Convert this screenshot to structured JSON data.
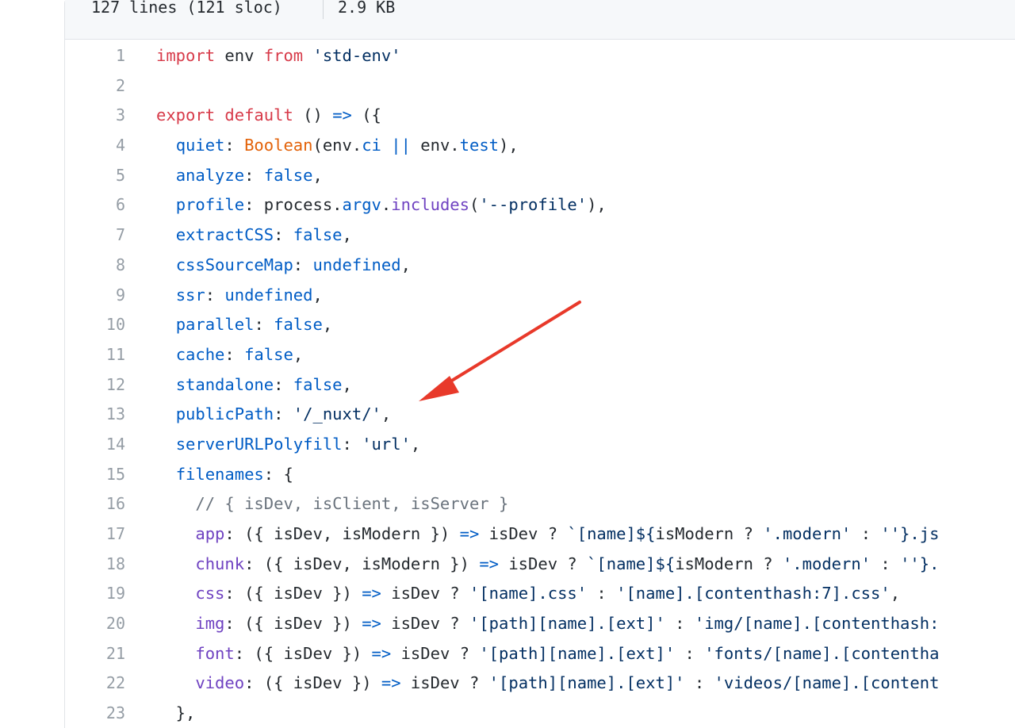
{
  "file_header": {
    "lines_info": "127 lines (121 sloc)",
    "size": "2.9 KB"
  },
  "annotation": {
    "type": "red-arrow",
    "color": "#e8392a",
    "points_to_line": 13
  },
  "colors": {
    "keyword": "#d73a49",
    "string": "#032f62",
    "comment": "#6a737d",
    "property": "#005cc5",
    "function": "#6f42c1",
    "builtin": "#e36209",
    "line_number": "#959da5"
  },
  "code": {
    "lines": [
      {
        "n": "1",
        "tokens": [
          [
            "k",
            "import"
          ],
          [
            "d",
            " env "
          ],
          [
            "k",
            "from"
          ],
          [
            "d",
            " "
          ],
          [
            "s",
            "'std-env'"
          ]
        ]
      },
      {
        "n": "2",
        "tokens": []
      },
      {
        "n": "3",
        "tokens": [
          [
            "k",
            "export"
          ],
          [
            "d",
            " "
          ],
          [
            "k",
            "default"
          ],
          [
            "d",
            " () "
          ],
          [
            "p",
            "=>"
          ],
          [
            "d",
            " ({"
          ]
        ]
      },
      {
        "n": "4",
        "tokens": [
          [
            "d",
            "  "
          ],
          [
            "p",
            "quiet"
          ],
          [
            "d",
            ": "
          ],
          [
            "b",
            "Boolean"
          ],
          [
            "d",
            "(env."
          ],
          [
            "p",
            "ci"
          ],
          [
            "d",
            " "
          ],
          [
            "p",
            "||"
          ],
          [
            "d",
            " env."
          ],
          [
            "p",
            "test"
          ],
          [
            "d",
            "),"
          ]
        ]
      },
      {
        "n": "5",
        "tokens": [
          [
            "d",
            "  "
          ],
          [
            "p",
            "analyze"
          ],
          [
            "d",
            ": "
          ],
          [
            "p",
            "false"
          ],
          [
            "d",
            ","
          ]
        ]
      },
      {
        "n": "6",
        "tokens": [
          [
            "d",
            "  "
          ],
          [
            "p",
            "profile"
          ],
          [
            "d",
            ": process."
          ],
          [
            "p",
            "argv"
          ],
          [
            "d",
            "."
          ],
          [
            "f",
            "includes"
          ],
          [
            "d",
            "("
          ],
          [
            "s",
            "'--profile'"
          ],
          [
            "d",
            "),"
          ]
        ]
      },
      {
        "n": "7",
        "tokens": [
          [
            "d",
            "  "
          ],
          [
            "p",
            "extractCSS"
          ],
          [
            "d",
            ": "
          ],
          [
            "p",
            "false"
          ],
          [
            "d",
            ","
          ]
        ]
      },
      {
        "n": "8",
        "tokens": [
          [
            "d",
            "  "
          ],
          [
            "p",
            "cssSourceMap"
          ],
          [
            "d",
            ": "
          ],
          [
            "p",
            "undefined"
          ],
          [
            "d",
            ","
          ]
        ]
      },
      {
        "n": "9",
        "tokens": [
          [
            "d",
            "  "
          ],
          [
            "p",
            "ssr"
          ],
          [
            "d",
            ": "
          ],
          [
            "p",
            "undefined"
          ],
          [
            "d",
            ","
          ]
        ]
      },
      {
        "n": "10",
        "tokens": [
          [
            "d",
            "  "
          ],
          [
            "p",
            "parallel"
          ],
          [
            "d",
            ": "
          ],
          [
            "p",
            "false"
          ],
          [
            "d",
            ","
          ]
        ]
      },
      {
        "n": "11",
        "tokens": [
          [
            "d",
            "  "
          ],
          [
            "p",
            "cache"
          ],
          [
            "d",
            ": "
          ],
          [
            "p",
            "false"
          ],
          [
            "d",
            ","
          ]
        ]
      },
      {
        "n": "12",
        "tokens": [
          [
            "d",
            "  "
          ],
          [
            "p",
            "standalone"
          ],
          [
            "d",
            ": "
          ],
          [
            "p",
            "false"
          ],
          [
            "d",
            ","
          ]
        ]
      },
      {
        "n": "13",
        "tokens": [
          [
            "d",
            "  "
          ],
          [
            "p",
            "publicPath"
          ],
          [
            "d",
            ": "
          ],
          [
            "s",
            "'/_nuxt/'"
          ],
          [
            "d",
            ","
          ]
        ]
      },
      {
        "n": "14",
        "tokens": [
          [
            "d",
            "  "
          ],
          [
            "p",
            "serverURLPolyfill"
          ],
          [
            "d",
            ": "
          ],
          [
            "s",
            "'url'"
          ],
          [
            "d",
            ","
          ]
        ]
      },
      {
        "n": "15",
        "tokens": [
          [
            "d",
            "  "
          ],
          [
            "p",
            "filenames"
          ],
          [
            "d",
            ": {"
          ]
        ]
      },
      {
        "n": "16",
        "tokens": [
          [
            "d",
            "    "
          ],
          [
            "c",
            "// { isDev, isClient, isServer }"
          ]
        ]
      },
      {
        "n": "17",
        "tokens": [
          [
            "d",
            "    "
          ],
          [
            "f",
            "app"
          ],
          [
            "d",
            ": ({ isDev, isModern }) "
          ],
          [
            "p",
            "=>"
          ],
          [
            "d",
            " isDev ? "
          ],
          [
            "s",
            "`[name]${"
          ],
          [
            "d",
            "isModern ? "
          ],
          [
            "s",
            "'.modern'"
          ],
          [
            "d",
            " : "
          ],
          [
            "s",
            "''"
          ],
          [
            "s",
            "}.js"
          ]
        ]
      },
      {
        "n": "18",
        "tokens": [
          [
            "d",
            "    "
          ],
          [
            "f",
            "chunk"
          ],
          [
            "d",
            ": ({ isDev, isModern }) "
          ],
          [
            "p",
            "=>"
          ],
          [
            "d",
            " isDev ? "
          ],
          [
            "s",
            "`[name]${"
          ],
          [
            "d",
            "isModern ? "
          ],
          [
            "s",
            "'.modern'"
          ],
          [
            "d",
            " : "
          ],
          [
            "s",
            "''"
          ],
          [
            "s",
            "}."
          ]
        ]
      },
      {
        "n": "19",
        "tokens": [
          [
            "d",
            "    "
          ],
          [
            "f",
            "css"
          ],
          [
            "d",
            ": ({ isDev }) "
          ],
          [
            "p",
            "=>"
          ],
          [
            "d",
            " isDev ? "
          ],
          [
            "s",
            "'[name].css'"
          ],
          [
            "d",
            " : "
          ],
          [
            "s",
            "'[name].[contenthash:7].css'"
          ],
          [
            "d",
            ","
          ]
        ]
      },
      {
        "n": "20",
        "tokens": [
          [
            "d",
            "    "
          ],
          [
            "f",
            "img"
          ],
          [
            "d",
            ": ({ isDev }) "
          ],
          [
            "p",
            "=>"
          ],
          [
            "d",
            " isDev ? "
          ],
          [
            "s",
            "'[path][name].[ext]'"
          ],
          [
            "d",
            " : "
          ],
          [
            "s",
            "'img/[name].[contenthash:"
          ]
        ]
      },
      {
        "n": "21",
        "tokens": [
          [
            "d",
            "    "
          ],
          [
            "f",
            "font"
          ],
          [
            "d",
            ": ({ isDev }) "
          ],
          [
            "p",
            "=>"
          ],
          [
            "d",
            " isDev ? "
          ],
          [
            "s",
            "'[path][name].[ext]'"
          ],
          [
            "d",
            " : "
          ],
          [
            "s",
            "'fonts/[name].[contentha"
          ]
        ]
      },
      {
        "n": "22",
        "tokens": [
          [
            "d",
            "    "
          ],
          [
            "f",
            "video"
          ],
          [
            "d",
            ": ({ isDev }) "
          ],
          [
            "p",
            "=>"
          ],
          [
            "d",
            " isDev ? "
          ],
          [
            "s",
            "'[path][name].[ext]'"
          ],
          [
            "d",
            " : "
          ],
          [
            "s",
            "'videos/[name].[content"
          ]
        ]
      },
      {
        "n": "23",
        "tokens": [
          [
            "d",
            "  },"
          ]
        ]
      }
    ]
  }
}
